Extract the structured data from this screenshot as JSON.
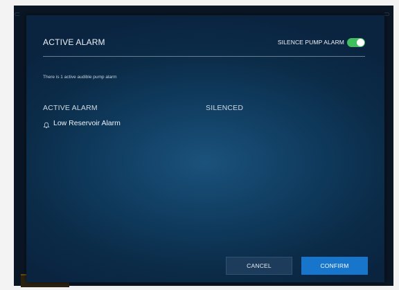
{
  "dialog": {
    "title": "ACTIVE ALARM",
    "silence_toggle": {
      "label": "SILENCE PUMP ALARM",
      "state": "on",
      "on_color": "#3fbf5f"
    },
    "info_text": "There is 1 active audible pump alarm"
  },
  "alarm_table": {
    "columns": [
      "ACTIVE ALARM",
      "SILENCED"
    ],
    "rows": [
      {
        "icon": "bell-icon",
        "name": "Low Reservoir Alarm",
        "silenced": ""
      }
    ]
  },
  "buttons": {
    "cancel_label": "CANCEL",
    "confirm_label": "CONFIRM",
    "confirm_color": "#1776cc"
  }
}
